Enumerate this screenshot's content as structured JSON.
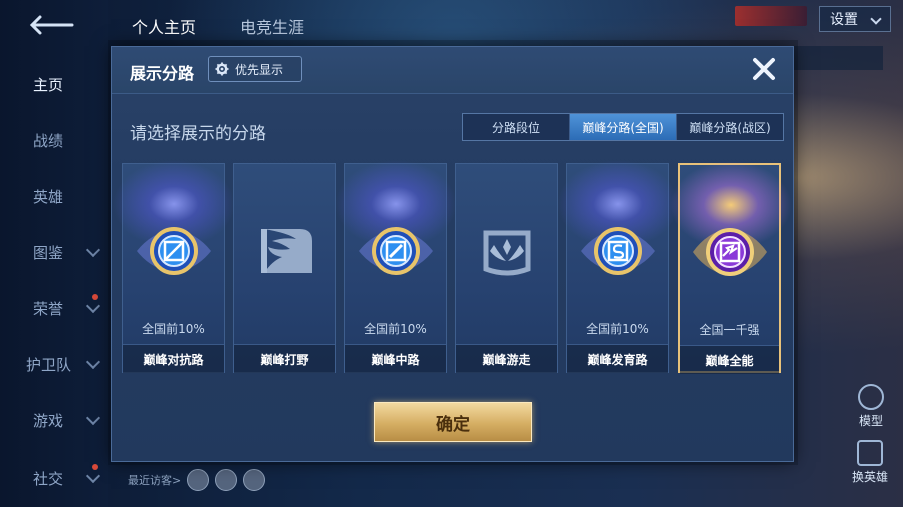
{
  "sidebar": {
    "items": [
      {
        "label": "主页",
        "active": true
      },
      {
        "label": "战绩"
      },
      {
        "label": "英雄"
      },
      {
        "label": "图鉴"
      },
      {
        "label": "荣誉"
      },
      {
        "label": "护卫队"
      },
      {
        "label": "游戏"
      },
      {
        "label": "社交"
      }
    ]
  },
  "topbar": {
    "tabs": [
      "个人主页",
      "电竞生涯"
    ],
    "settings_label": "设置"
  },
  "right_panel": {
    "model_label": "模型",
    "swap_label": "换英雄"
  },
  "visitors": {
    "label": "最近访客>"
  },
  "modal": {
    "title": "展示分路",
    "priority_label": "优先显示",
    "prompt": "请选择展示的分路",
    "segment_tabs": [
      "分路段位",
      "巅峰分路(全国)",
      "巅峰分路(战区)"
    ],
    "selected_tab": 1,
    "cards": [
      {
        "rank": "全国前10%",
        "lane": "巅峰对抗路",
        "emblem": "sword-emblem-icon",
        "locked": false
      },
      {
        "rank": "",
        "lane": "巅峰打野",
        "emblem": "dragon-emblem-icon",
        "locked": true
      },
      {
        "rank": "全国前10%",
        "lane": "巅峰中路",
        "emblem": "wand-emblem-icon",
        "locked": false
      },
      {
        "rank": "",
        "lane": "巅峰游走",
        "emblem": "wings-emblem-icon",
        "locked": true
      },
      {
        "rank": "全国前10%",
        "lane": "巅峰发育路",
        "emblem": "target-emblem-icon",
        "locked": false
      },
      {
        "rank": "全国一千强",
        "lane": "巅峰全能",
        "emblem": "allround-emblem-icon",
        "locked": false,
        "selected": true
      }
    ],
    "confirm_label": "确定"
  },
  "colors": {
    "accent_blue": "#2c6cb6",
    "gold": "#d5ae63",
    "selected_border": "#e8c27a"
  }
}
